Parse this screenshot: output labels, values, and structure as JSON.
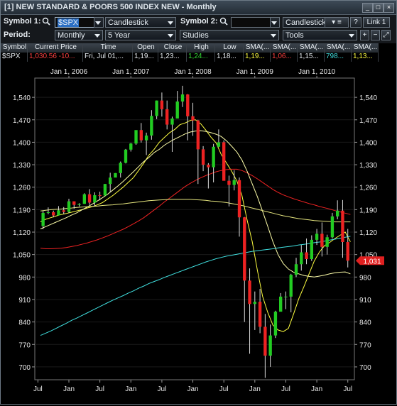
{
  "window": {
    "title": "[1] NEW STANDARD & POORS 500 INDEX NEW - Monthly"
  },
  "toolbar1": {
    "symbol1_label": "Symbol 1:",
    "symbol1_value": "$SPX",
    "chart_type": "Candlestick",
    "symbol2_label": "Symbol 2:",
    "symbol2_value": "",
    "chart_type2": "Candlestick",
    "help_label": "?",
    "link_label": "Link 1"
  },
  "toolbar2": {
    "period_label": "Period:",
    "period_value": "Monthly",
    "range_value": "5 Year",
    "studies_label": "Studies",
    "tools_label": "Tools"
  },
  "quote": {
    "headers": [
      "Symbol",
      "Current Price",
      "Time",
      "Open",
      "Close",
      "High",
      "Low",
      "SMA(...",
      "SMA(...",
      "SMA(...",
      "SMA(...",
      "SMA(..."
    ],
    "values": [
      {
        "text": "$SPX",
        "color": "#e8edf2"
      },
      {
        "text": "1,030.56 -10...",
        "color": "#ff4040"
      },
      {
        "text": "Fri, Jul 01,...",
        "color": "#e8edf2"
      },
      {
        "text": "1,19...",
        "color": "#e8edf2"
      },
      {
        "text": "1,23...",
        "color": "#e8edf2"
      },
      {
        "text": "1,24...",
        "color": "#33dd33"
      },
      {
        "text": "1,18...",
        "color": "#e8edf2"
      },
      {
        "text": "1,19...",
        "color": "#ffff40"
      },
      {
        "text": "1,06...",
        "color": "#ff4040"
      },
      {
        "text": "1,15...",
        "color": "#e8edf2"
      },
      {
        "text": "798...",
        "color": "#40e0e0"
      },
      {
        "text": "1,13...",
        "color": "#ffff40"
      }
    ]
  },
  "chart_data": {
    "type": "candlestick",
    "title": "",
    "period": "Monthly",
    "ylim": [
      660,
      1600
    ],
    "y_ticks": [
      1540,
      1470,
      1400,
      1330,
      1260,
      1190,
      1120,
      1050,
      980,
      910,
      840,
      770,
      700
    ],
    "y_tick_labels": [
      "1,540",
      "1,470",
      "1,400",
      "1,330",
      "1,260",
      "1,190",
      "1,120",
      "1,050",
      "980",
      "910",
      "840",
      "770",
      "700"
    ],
    "top_labels": [
      {
        "label": "Jan 1, 2006",
        "index": 5
      },
      {
        "label": "Jan 1, 2007",
        "index": 17
      },
      {
        "label": "Jan 1, 2008",
        "index": 29
      },
      {
        "label": "Jan 1, 2009",
        "index": 41
      },
      {
        "label": "Jan 1, 2010",
        "index": 53
      }
    ],
    "bottom_labels": [
      {
        "label": "Jul",
        "index": -1
      },
      {
        "label": "Jan",
        "index": 5
      },
      {
        "label": "Jul",
        "index": 11
      },
      {
        "label": "Jan",
        "index": 17
      },
      {
        "label": "Jul",
        "index": 23
      },
      {
        "label": "Jan",
        "index": 29
      },
      {
        "label": "Jul",
        "index": 35
      },
      {
        "label": "Jan",
        "index": 41
      },
      {
        "label": "Jul",
        "index": 47
      },
      {
        "label": "Jan",
        "index": 53
      },
      {
        "label": "Jul",
        "index": 59
      }
    ],
    "current_price_label": "1,031",
    "colors": {
      "up": "#22cc22",
      "down": "#ee2222",
      "background": "#000000",
      "grid": "#1a1a1a",
      "axis_text": "#e8e8e8",
      "price_tag": "#e02020"
    },
    "ohlc": [
      [
        1139,
        1187,
        1129,
        1180
      ],
      [
        1180,
        1197,
        1176,
        1182
      ],
      [
        1182,
        1187,
        1166,
        1172
      ],
      [
        1172,
        1201,
        1172,
        1188
      ],
      [
        1188,
        1198,
        1176,
        1183
      ],
      [
        1183,
        1224,
        1180,
        1216
      ],
      [
        1216,
        1214,
        1193,
        1205
      ],
      [
        1205,
        1210,
        1200,
        1208
      ],
      [
        1208,
        1241,
        1208,
        1238
      ],
      [
        1238,
        1254,
        1205,
        1212
      ],
      [
        1212,
        1244,
        1200,
        1235
      ],
      [
        1235,
        1246,
        1219,
        1234
      ],
      [
        1234,
        1236,
        1270,
        1270
      ],
      [
        1270,
        1305,
        1245,
        1290
      ],
      [
        1290,
        1304,
        1300,
        1304
      ],
      [
        1304,
        1340,
        1290,
        1336
      ],
      [
        1336,
        1379,
        1334,
        1377
      ],
      [
        1377,
        1398,
        1371,
        1396
      ],
      [
        1396,
        1437,
        1392,
        1438
      ],
      [
        1438,
        1460,
        1399,
        1406
      ],
      [
        1406,
        1430,
        1360,
        1421
      ],
      [
        1421,
        1500,
        1408,
        1482
      ],
      [
        1482,
        1530,
        1472,
        1530
      ],
      [
        1530,
        1555,
        1480,
        1503
      ],
      [
        1503,
        1530,
        1440,
        1455
      ],
      [
        1455,
        1480,
        1370,
        1474
      ],
      [
        1474,
        1560,
        1474,
        1527
      ],
      [
        1527,
        1576,
        1510,
        1549
      ],
      [
        1549,
        1550,
        1406,
        1481
      ],
      [
        1481,
        1523,
        1420,
        1468
      ],
      [
        1468,
        1470,
        1270,
        1378
      ],
      [
        1378,
        1388,
        1310,
        1330
      ],
      [
        1330,
        1335,
        1256,
        1322
      ],
      [
        1322,
        1395,
        1275,
        1386
      ],
      [
        1386,
        1440,
        1385,
        1400
      ],
      [
        1400,
        1406,
        1325,
        1280
      ],
      [
        1280,
        1296,
        1200,
        1267
      ],
      [
        1267,
        1313,
        1250,
        1282
      ],
      [
        1282,
        1290,
        1106,
        1166
      ],
      [
        1166,
        1167,
        840,
        969
      ],
      [
        969,
        1007,
        741,
        896
      ],
      [
        896,
        935,
        815,
        903
      ],
      [
        903,
        943,
        805,
        825
      ],
      [
        825,
        865,
        666,
        735
      ],
      [
        735,
        832,
        700,
        798
      ],
      [
        798,
        875,
        790,
        872
      ],
      [
        872,
        930,
        880,
        919
      ],
      [
        919,
        935,
        880,
        919
      ],
      [
        919,
        990,
        870,
        987
      ],
      [
        987,
        1040,
        980,
        1020
      ],
      [
        1020,
        1080,
        1000,
        1057
      ],
      [
        1057,
        1100,
        1020,
        1036
      ],
      [
        1036,
        1110,
        1030,
        1096
      ],
      [
        1096,
        1130,
        1080,
        1115
      ],
      [
        1115,
        1150,
        1044,
        1074
      ],
      [
        1074,
        1112,
        1050,
        1104
      ],
      [
        1104,
        1180,
        1100,
        1169
      ],
      [
        1169,
        1219,
        1160,
        1187
      ],
      [
        1187,
        1220,
        1040,
        1089
      ],
      [
        1089,
        1130,
        1010,
        1031
      ]
    ],
    "overlays": [
      {
        "name": "SMA(...)",
        "color": "#ffff40",
        "values": [
          1152,
          1160,
          1165,
          1170,
          1175,
          1178,
          1182,
          1186,
          1190,
          1195,
          1199,
          1205,
          1212,
          1223,
          1234,
          1247,
          1260,
          1275,
          1290,
          1312,
          1335,
          1360,
          1378,
          1400,
          1415,
          1430,
          1440,
          1455,
          1460,
          1468,
          1470,
          1458,
          1438,
          1416,
          1398,
          1362,
          1336,
          1310,
          1280,
          1235,
          1158,
          1090,
          1000,
          920,
          870,
          830,
          815,
          810,
          820,
          865,
          912,
          950,
          990,
          1030,
          1058,
          1078,
          1088,
          1100,
          1110,
          1120,
          1090
        ]
      },
      {
        "name": "SMA(...)",
        "color": "#ee2222",
        "values": [
          1070,
          1068,
          1068,
          1069,
          1070,
          1072,
          1075,
          1078,
          1082,
          1086,
          1091,
          1096,
          1102,
          1108,
          1115,
          1122,
          1129,
          1137,
          1146,
          1155,
          1165,
          1177,
          1189,
          1201,
          1214,
          1226,
          1238,
          1250,
          1262,
          1272,
          1281,
          1289,
          1296,
          1302,
          1308,
          1312,
          1315,
          1316,
          1316,
          1312,
          1305,
          1296,
          1286,
          1275,
          1264,
          1253,
          1244,
          1236,
          1230,
          1224,
          1219,
          1214,
          1209,
          1205,
          1200,
          1196,
          1192,
          1187,
          1183,
          1179,
          1175
        ]
      },
      {
        "name": "SMA(...)",
        "color": "#ffffaa",
        "values": [
          1130,
          1137,
          1144,
          1151,
          1158,
          1165,
          1173,
          1180,
          1189,
          1198,
          1207,
          1217,
          1227,
          1238,
          1251,
          1264,
          1278,
          1293,
          1308,
          1324,
          1340,
          1353,
          1368,
          1378,
          1391,
          1401,
          1410,
          1418,
          1426,
          1432,
          1435,
          1436,
          1434,
          1430,
          1425,
          1418,
          1405,
          1388,
          1370,
          1345,
          1310,
          1270,
          1230,
          1185,
          1138,
          1090,
          1050,
          1022,
          1005,
          995,
          990,
          985,
          982,
          980,
          983,
          986,
          990,
          993,
          995,
          996,
          990
        ]
      },
      {
        "name": "SMA(...)",
        "color": "#40e0e0",
        "values": [
          798,
          805,
          812,
          820,
          828,
          836,
          845,
          852,
          860,
          868,
          876,
          884,
          892,
          900,
          908,
          915,
          922,
          930,
          937,
          945,
          952,
          960,
          966,
          972,
          979,
          985,
          991,
          997,
          1003,
          1009,
          1015,
          1021,
          1027,
          1032,
          1037,
          1041,
          1045,
          1048,
          1051,
          1054,
          1057,
          1060,
          1062,
          1064,
          1066,
          1068,
          1071,
          1073,
          1075,
          1077,
          1080,
          1082,
          1084,
          1087,
          1089,
          1092,
          1095,
          1098,
          1101,
          1104,
          1107
        ]
      },
      {
        "name": "SMA(...)",
        "color": "#e8e880",
        "values": [
          1186,
          1188,
          1190,
          1191,
          1192,
          1194,
          1195,
          1197,
          1198,
          1199,
          1200,
          1201,
          1203,
          1204,
          1205,
          1207,
          1208,
          1210,
          1212,
          1214,
          1216,
          1218,
          1219,
          1220,
          1221,
          1222,
          1222,
          1222,
          1222,
          1222,
          1221,
          1220,
          1219,
          1217,
          1216,
          1214,
          1212,
          1209,
          1206,
          1203,
          1199,
          1195,
          1191,
          1187,
          1183,
          1179,
          1175,
          1171,
          1168,
          1165,
          1162,
          1160,
          1158,
          1156,
          1155,
          1154,
          1153,
          1152,
          1152,
          1152,
          1152
        ]
      }
    ]
  }
}
